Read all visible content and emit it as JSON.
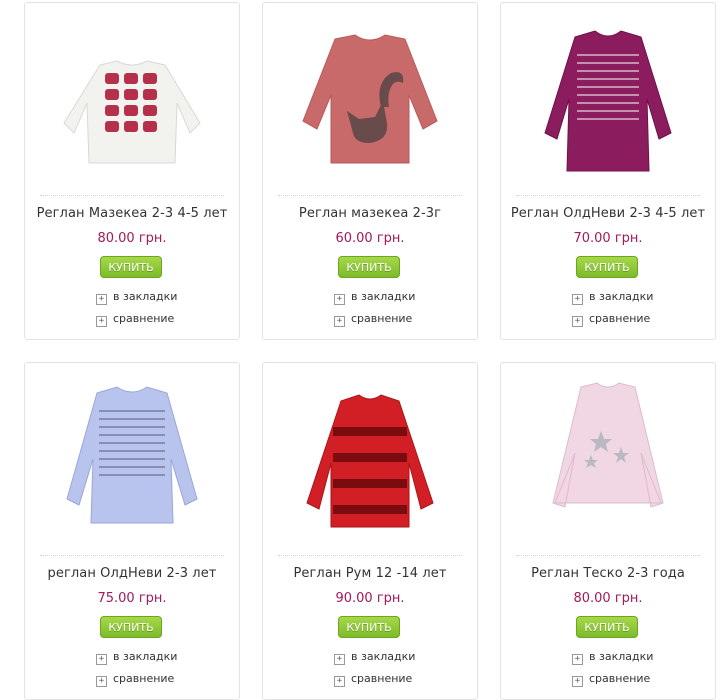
{
  "products": [
    {
      "name": "Реглан Мазекеа 2-3 4-5 лет",
      "price": "80.00 грн.",
      "buy": "КУПИТЬ",
      "bookmark": "в закладки",
      "compare": "сравнение",
      "image": "white-sweater-cat-print",
      "color": "#f2f2ef",
      "accent": "#b5304a"
    },
    {
      "name": "Реглан мазекеа 2-3г",
      "price": "60.00 грн.",
      "buy": "КУПИТЬ",
      "bookmark": "в закладки",
      "compare": "сравнение",
      "image": "rose-sweater-cat-print",
      "color": "#c96a6a",
      "accent": "#6a4b4b"
    },
    {
      "name": "Реглан ОлдНеви 2-3 4-5 лет",
      "price": "70.00 грн.",
      "buy": "КУПИТЬ",
      "bookmark": "в закладки",
      "compare": "сравнение",
      "image": "purple-sweater-text-print",
      "color": "#8b1d5e",
      "accent": "#e8d3e0"
    },
    {
      "name": "реглан ОлдНеви 2-3 лет",
      "price": "75.00 грн.",
      "buy": "КУПИТЬ",
      "bookmark": "в закладки",
      "compare": "сравнение",
      "image": "lavender-sweater-text-print",
      "color": "#b9c4ee",
      "accent": "#6a6a8a"
    },
    {
      "name": "Реглан Рум 12 -14 лет",
      "price": "90.00 грн.",
      "buy": "КУПИТЬ",
      "bookmark": "в закладки",
      "compare": "сравнение",
      "image": "red-sweater-sequin-stripes",
      "color": "#d21f25",
      "accent": "#7a0c10"
    },
    {
      "name": "Реглан Теско 2-3 года",
      "price": "80.00 грн.",
      "buy": "КУПИТЬ",
      "bookmark": "в закладки",
      "compare": "сравнение",
      "image": "pink-sweater-stars",
      "color": "#f1d6e3",
      "accent": "#b9b9c4"
    }
  ]
}
